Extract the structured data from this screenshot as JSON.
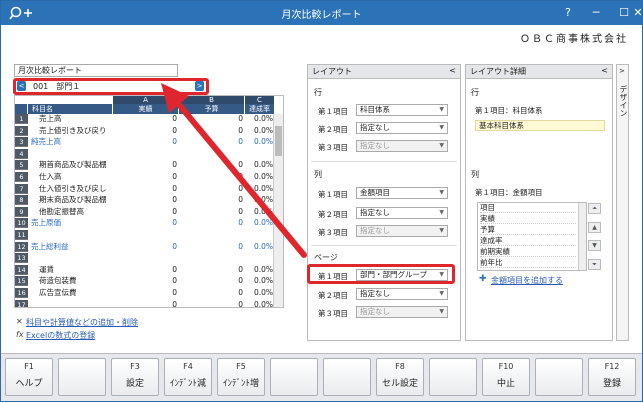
{
  "window": {
    "title": "月次比較レポート",
    "company": "ＯＢＣ商事株式会社"
  },
  "report": {
    "name": "月次比較レポート",
    "dept": "001　部門１"
  },
  "grid": {
    "col_letters": [
      "A",
      "B",
      "C"
    ],
    "headers": [
      "科目名",
      "実績",
      "予算",
      "達成率"
    ],
    "rows": [
      {
        "num": "1",
        "name": "売上高",
        "actual": "0",
        "budget": "0",
        "rate": "0.0%",
        "blue": false,
        "indent": true
      },
      {
        "num": "2",
        "name": "売上値引き及び戻り",
        "actual": "0",
        "budget": "0",
        "rate": "0.0%",
        "blue": false,
        "indent": true
      },
      {
        "num": "3",
        "name": "純売上高",
        "actual": "0",
        "budget": "0",
        "rate": "0.0%",
        "blue": true,
        "indent": false
      },
      {
        "num": "4",
        "name": "",
        "actual": "",
        "budget": "",
        "rate": "",
        "blue": false,
        "indent": false
      },
      {
        "num": "5",
        "name": "期首商品及び製品棚",
        "actual": "0",
        "budget": "0",
        "rate": "0.0%",
        "blue": false,
        "indent": true
      },
      {
        "num": "6",
        "name": "仕入高",
        "actual": "0",
        "budget": "0",
        "rate": "0.0%",
        "blue": false,
        "indent": true
      },
      {
        "num": "7",
        "name": "仕入値引き及び戻し",
        "actual": "0",
        "budget": "0",
        "rate": "0.0%",
        "blue": false,
        "indent": true
      },
      {
        "num": "8",
        "name": "期末商品及び製品棚",
        "actual": "0",
        "budget": "0",
        "rate": "0.0%",
        "blue": false,
        "indent": true
      },
      {
        "num": "9",
        "name": "他勘定振替高",
        "actual": "0",
        "budget": "0",
        "rate": "0.0%",
        "blue": false,
        "indent": true
      },
      {
        "num": "10",
        "name": "売上原価",
        "actual": "0",
        "budget": "0",
        "rate": "0.0%",
        "blue": true,
        "indent": false
      },
      {
        "num": "11",
        "name": "",
        "actual": "",
        "budget": "",
        "rate": "",
        "blue": false,
        "indent": false
      },
      {
        "num": "12",
        "name": "売上総利益",
        "actual": "0",
        "budget": "0",
        "rate": "0.0%",
        "blue": true,
        "indent": false
      },
      {
        "num": "13",
        "name": "",
        "actual": "",
        "budget": "",
        "rate": "",
        "blue": false,
        "indent": false
      },
      {
        "num": "14",
        "name": "運賃",
        "actual": "0",
        "budget": "0",
        "rate": "0.0%",
        "blue": false,
        "indent": true
      },
      {
        "num": "15",
        "name": "荷造包装費",
        "actual": "0",
        "budget": "0",
        "rate": "0.0%",
        "blue": false,
        "indent": true
      },
      {
        "num": "16",
        "name": "広告宣伝費",
        "actual": "0",
        "budget": "0",
        "rate": "0.0%",
        "blue": false,
        "indent": true
      },
      {
        "num": "17",
        "name": "",
        "actual": "0",
        "budget": "0",
        "rate": "0.0%",
        "blue": false,
        "indent": true
      }
    ]
  },
  "links": {
    "add_item": "科目や計算値などの追加・削除",
    "excel": "Excelの数式の登録"
  },
  "layout": {
    "title": "レイアウト",
    "row_section": "行",
    "col_section": "列",
    "page_section": "ページ",
    "item1": "第１項目",
    "item2": "第２項目",
    "item3": "第３項目",
    "row": [
      "科目体系",
      "指定なし",
      "指定なし"
    ],
    "col": [
      "金額項目",
      "指定なし",
      "指定なし"
    ],
    "page": [
      "部門・部門グループ",
      "指定なし",
      "指定なし"
    ]
  },
  "detail": {
    "title": "レイアウト詳細",
    "row_section": "行",
    "row_item_label": "第１項目：科目体系",
    "row_item_value": "基本科目体系",
    "col_section": "列",
    "col_item_label": "第１項目：金額項目",
    "list": [
      "項目",
      "実績",
      "予算",
      "達成率",
      "前期実績",
      "前年比"
    ],
    "add_link": "金額項目を追加する"
  },
  "design_tab": "デザイン",
  "fkeys": [
    {
      "key": "F1",
      "label": "ヘルプ"
    },
    {
      "key": "",
      "label": ""
    },
    {
      "key": "F3",
      "label": "設定"
    },
    {
      "key": "F4",
      "label": "ｲﾝﾃﾞﾝﾄ減"
    },
    {
      "key": "F5",
      "label": "ｲﾝﾃﾞﾝﾄ増"
    },
    {
      "key": "",
      "label": ""
    },
    {
      "key": "",
      "label": ""
    },
    {
      "key": "F8",
      "label": "セル設定"
    },
    {
      "key": "",
      "label": ""
    },
    {
      "key": "F10",
      "label": "中止"
    },
    {
      "key": "",
      "label": ""
    },
    {
      "key": "F12",
      "label": "登録"
    }
  ],
  "colors": {
    "accent": "#2b72b6",
    "highlight": "#e0262d",
    "blue_text": "#2a6ac2"
  }
}
